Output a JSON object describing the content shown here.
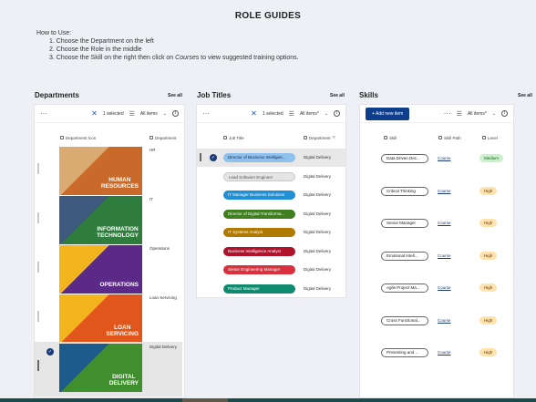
{
  "page": {
    "title": "ROLE GUIDES",
    "howto_heading": "How to Use:",
    "steps": [
      "1. Choose the Department on the left",
      "2. Choose the Role in the middle",
      "3. Choose the Skill on the right then click on"
    ],
    "step3_emph": "Courses",
    "step3_tail": " to view suggested training options."
  },
  "departments": {
    "title": "Departments",
    "see_all": "See all",
    "toolbar": {
      "dots": "···",
      "selected": "1 selected",
      "filter": "All items",
      "info": "i"
    },
    "col_icon": "Department Icon",
    "col_name": "Department",
    "rows": [
      {
        "img_text": "HUMAN\nRESOURCES",
        "name": "HR",
        "bg": "#c96a2b",
        "bg2": "#d9aa72",
        "selected": false
      },
      {
        "img_text": "INFORMATION\nTECHNOLOGY",
        "name": "IT",
        "bg": "#2e7d3c",
        "bg2": "#3e5a7e",
        "selected": false
      },
      {
        "img_text": "OPERATIONS",
        "name": "Operations",
        "bg": "#5b2a86",
        "bg2": "#f2b51e",
        "selected": false
      },
      {
        "img_text": "LOAN\nSERVICING",
        "name": "Loan Servicing",
        "bg": "#e0561b",
        "bg2": "#f2b51e",
        "selected": false
      },
      {
        "img_text": "DIGITAL\nDELIVERY",
        "name": "Digital Delivery",
        "bg": "#3f8f2f",
        "bg2": "#1c5b8c",
        "selected": true
      }
    ]
  },
  "jobs": {
    "title": "Job Titles",
    "see_all": "See all",
    "toolbar": {
      "dots": "···",
      "selected": "1 selected",
      "filter": "All items*",
      "info": "i"
    },
    "col_title": "Job Title",
    "col_dept": "Department",
    "rows": [
      {
        "label": "Director of Business Intelligen...",
        "color": "#8fc1ef",
        "text_color": "#1a2b4a",
        "dept": "Digital Delivery",
        "selected": true
      },
      {
        "label": "Lead Software Engineer",
        "color": "#e4e4e4",
        "text_color": "#555555",
        "dept": "Digital Delivery",
        "selected": false
      },
      {
        "label": "IT Manager Business Solutions",
        "color": "#1f8fd6",
        "text_color": "#ffffff",
        "dept": "Digital Delivery",
        "selected": false
      },
      {
        "label": "Director of Digital Transforma...",
        "color": "#3f7f1f",
        "text_color": "#ffffff",
        "dept": "Digital Delivery",
        "selected": false
      },
      {
        "label": "IT Systems Analyst",
        "color": "#b07a00",
        "text_color": "#ffffff",
        "dept": "Digital Delivery",
        "selected": false
      },
      {
        "label": "Business Intelligence Analyst",
        "color": "#b0122c",
        "text_color": "#ffffff",
        "dept": "Digital Delivery",
        "selected": false
      },
      {
        "label": "Senior Engineering Manager",
        "color": "#d8313d",
        "text_color": "#ffffff",
        "dept": "Digital Delivery",
        "selected": false
      },
      {
        "label": "Product Manager",
        "color": "#108a6e",
        "text_color": "#ffffff",
        "dept": "Digital Delivery",
        "selected": false
      }
    ]
  },
  "skills": {
    "title": "Skills",
    "see_all": "See all",
    "toolbar": {
      "add_label": "+ Add new item",
      "dots": "···",
      "filter": "All items*",
      "info": "i"
    },
    "col_skill": "Skill",
    "col_path": "Skill Path",
    "col_level": "Level",
    "rows": [
      {
        "skill": "Data Driven Dec...",
        "course": "Course",
        "level": "Medium"
      },
      {
        "skill": "Critical Thinking",
        "course": "Course",
        "level": "High"
      },
      {
        "skill": "Senior Manager",
        "course": "Course",
        "level": "High"
      },
      {
        "skill": "Emotional Intell...",
        "course": "Course",
        "level": "High"
      },
      {
        "skill": "Agile Project Ma...",
        "course": "Course",
        "level": "High"
      },
      {
        "skill": "Cross Functional...",
        "course": "Course",
        "level": "High"
      },
      {
        "skill": "Presenting and ...",
        "course": "Course",
        "level": "High"
      }
    ]
  }
}
